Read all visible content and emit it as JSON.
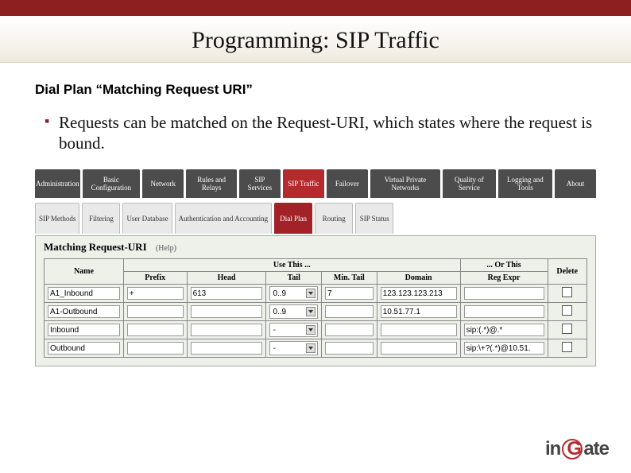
{
  "slide": {
    "title": "Programming: SIP Traffic",
    "subtitle": "Dial Plan  “Matching Request URI”",
    "bullet": "Requests can be matched on the Request-URI,  which states where the request is bound."
  },
  "ui": {
    "nav": [
      "Administration",
      "Basic Configuration",
      "Network",
      "Rules and Relays",
      "SIP Services",
      "SIP Traffic",
      "Failover",
      "Virtual Private Networks",
      "Quality of Service",
      "Logging and Tools",
      "About"
    ],
    "nav_active_index": 5,
    "subnav": [
      "SIP Methods",
      "Filtering",
      "User Database",
      "Authentication and Accounting",
      "Dial Plan",
      "Routing",
      "SIP Status"
    ],
    "subnav_active_index": 4,
    "panel_title": "Matching Request-URI",
    "help_label": "(Help)",
    "columns": {
      "name": "Name",
      "group_use": "Use This ...",
      "group_or": "... Or This",
      "prefix": "Prefix",
      "head": "Head",
      "tail": "Tail",
      "min_tail": "Min. Tail",
      "domain": "Domain",
      "regexpr": "Reg Expr",
      "delete": "Delete"
    },
    "rows": [
      {
        "name": "A1_Inbound",
        "prefix": "+",
        "head": "613",
        "tail": "0..9",
        "min_tail": "7",
        "domain": "123.123.123.213",
        "reg": ""
      },
      {
        "name": "A1-Outbound",
        "prefix": "",
        "head": "",
        "tail": "0..9",
        "min_tail": "",
        "domain": "10.51.77.1",
        "reg": ""
      },
      {
        "name": "Inbound",
        "prefix": "",
        "head": "",
        "tail": "-",
        "min_tail": "",
        "domain": "",
        "reg": "sip:(.*)@.*"
      },
      {
        "name": "Outbound",
        "prefix": "",
        "head": "",
        "tail": "-",
        "min_tail": "",
        "domain": "",
        "reg": "sip:\\+?(.*)@10.51."
      }
    ]
  },
  "logo": {
    "prefix": "in",
    "g": "G",
    "suffix": "ate"
  }
}
